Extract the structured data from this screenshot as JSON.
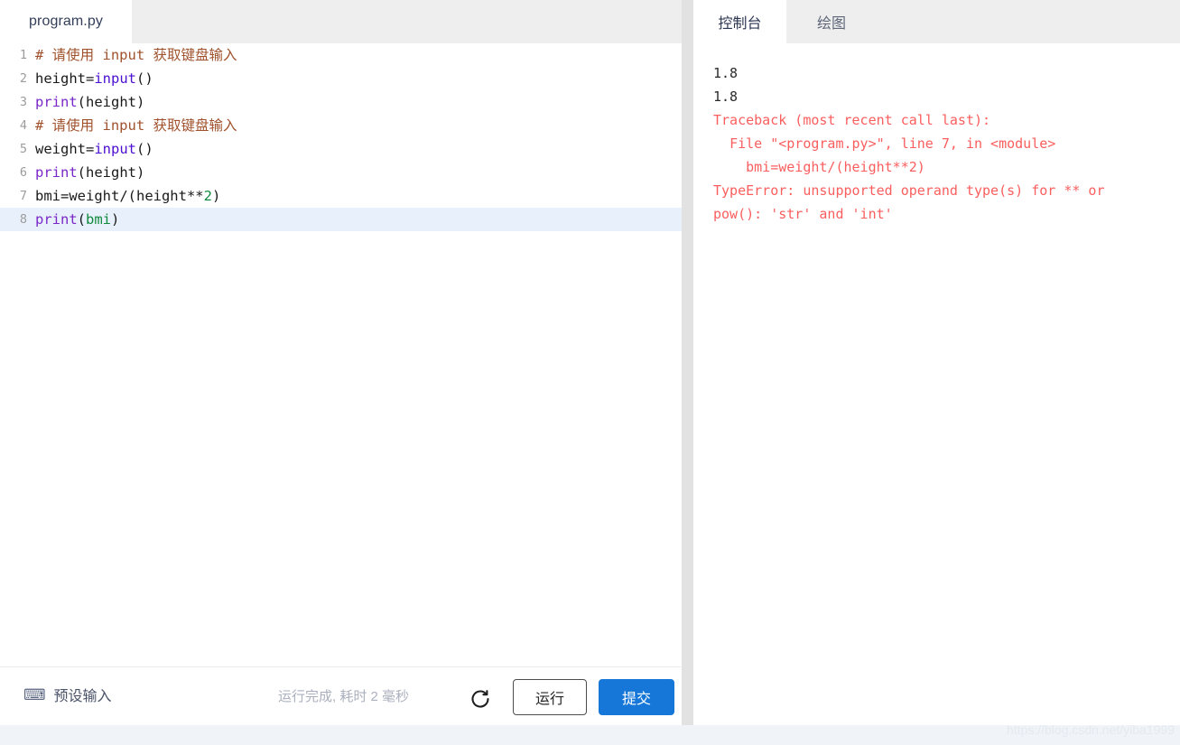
{
  "editor": {
    "tab": {
      "filename": "program.py",
      "icon": "file-python-icon"
    },
    "code_lines": [
      {
        "number": "1",
        "tokens": [
          {
            "text": "# 请使用 input 获取键盘输入",
            "type": "comment"
          }
        ]
      },
      {
        "number": "2",
        "tokens": [
          {
            "text": "height=",
            "type": "plain"
          },
          {
            "text": "input",
            "type": "builtin"
          },
          {
            "text": "()",
            "type": "plain"
          }
        ]
      },
      {
        "number": "3",
        "tokens": [
          {
            "text": "print",
            "type": "func"
          },
          {
            "text": "(height)",
            "type": "plain"
          }
        ]
      },
      {
        "number": "4",
        "tokens": [
          {
            "text": "# 请使用 input 获取键盘输入",
            "type": "comment"
          }
        ]
      },
      {
        "number": "5",
        "tokens": [
          {
            "text": "weight=",
            "type": "plain"
          },
          {
            "text": "input",
            "type": "builtin"
          },
          {
            "text": "()",
            "type": "plain"
          }
        ]
      },
      {
        "number": "6",
        "tokens": [
          {
            "text": "print",
            "type": "func"
          },
          {
            "text": "(height)",
            "type": "plain"
          }
        ]
      },
      {
        "number": "7",
        "tokens": [
          {
            "text": "bmi=weight/(height**",
            "type": "plain"
          },
          {
            "text": "2",
            "type": "num"
          },
          {
            "text": ")",
            "type": "plain"
          }
        ]
      },
      {
        "number": "8",
        "active": true,
        "tokens": [
          {
            "text": "print",
            "type": "func"
          },
          {
            "text": "(",
            "type": "plain"
          },
          {
            "text": "bmi",
            "type": "var"
          },
          {
            "text": ")",
            "type": "plain"
          }
        ]
      }
    ],
    "footer": {
      "keyboard_icon": "keyboard-icon",
      "preset_input_label": "预设输入",
      "run_status": "运行完成, 耗时 2 毫秒",
      "refresh_icon": "refresh-icon",
      "run_button_label": "运行",
      "submit_button_label": "提交"
    }
  },
  "console": {
    "tabs": [
      {
        "label": "控制台",
        "active": true
      },
      {
        "label": "绘图",
        "active": false
      }
    ],
    "output_lines": [
      {
        "text": "1.8",
        "type": "normal"
      },
      {
        "text": "1.8",
        "type": "normal"
      },
      {
        "text": "Traceback (most recent call last):",
        "type": "error"
      },
      {
        "text": "  File \"<program.py>\", line 7, in <module>",
        "type": "error"
      },
      {
        "text": "    bmi=weight/(height**2)",
        "type": "error"
      },
      {
        "text": "TypeError: unsupported operand type(s) for ** or pow(): 'str' and 'int'",
        "type": "error"
      }
    ]
  },
  "watermark": {
    "text": "https://blog.csdn.net/yiba1999"
  },
  "colors": {
    "accent": "#1677d9",
    "error": "#fa5e5e",
    "comment": "#a0522d",
    "builtin": "#4b0fd2",
    "function": "#7a28c8",
    "number": "#0f8a3c",
    "active_line": "#e8f0fb",
    "tabbar": "#eeeeee"
  }
}
